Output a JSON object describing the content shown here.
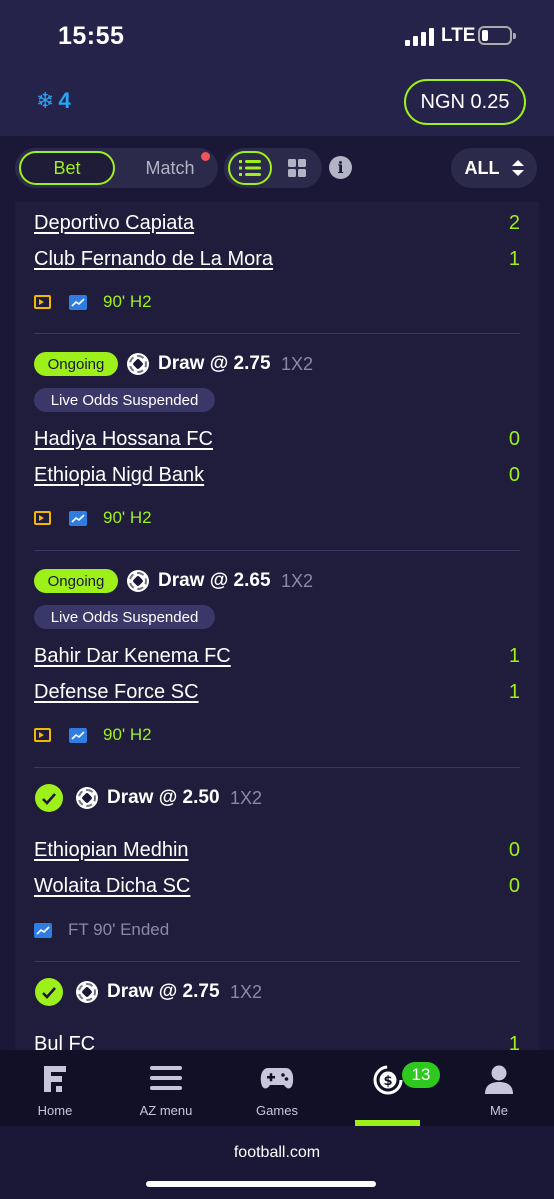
{
  "status_bar": {
    "time": "15:55",
    "network": "LTE"
  },
  "header": {
    "freeze_count": "4",
    "balance": "NGN 0.25"
  },
  "tabs": {
    "bet": "Bet",
    "match": "Match",
    "filter": "ALL"
  },
  "bets": [
    {
      "status": "",
      "pick": "",
      "market": "",
      "suspended": "",
      "home": "Deportivo Capiata",
      "away": "Club Fernando de La Mora",
      "home_score": "2",
      "away_score": "1",
      "time": "90' H2"
    },
    {
      "status": "Ongoing",
      "pick": "Draw @ 2.75",
      "market": "1X2",
      "suspended": "Live Odds Suspended",
      "home": "Hadiya Hossana FC",
      "away": "Ethiopia Nigd Bank",
      "home_score": "0",
      "away_score": "0",
      "time": "90' H2"
    },
    {
      "status": "Ongoing",
      "pick": "Draw @ 2.65",
      "market": "1X2",
      "suspended": "Live Odds Suspended",
      "home": "Bahir Dar Kenema FC",
      "away": "Defense Force SC",
      "home_score": "1",
      "away_score": "1",
      "time": "90' H2"
    },
    {
      "status": "won",
      "pick": "Draw @ 2.50",
      "market": "1X2",
      "suspended": "",
      "home": "Ethiopian Medhin",
      "away": "Wolaita Dicha SC",
      "home_score": "0",
      "away_score": "0",
      "time": "FT 90' Ended"
    },
    {
      "status": "won",
      "pick": "Draw @ 2.75",
      "market": "1X2",
      "suspended": "",
      "home": "Bul FC",
      "away": "",
      "home_score": "1",
      "away_score": "",
      "time": ""
    }
  ],
  "nav": {
    "home": "Home",
    "az_menu": "AZ menu",
    "games": "Games",
    "me": "Me",
    "badge": "13"
  },
  "browser": {
    "url": "football.com"
  },
  "colors": {
    "accent": "#9ef01a",
    "background": "#1a1836",
    "header": "#25234a",
    "freeze": "#2aa4f4"
  }
}
